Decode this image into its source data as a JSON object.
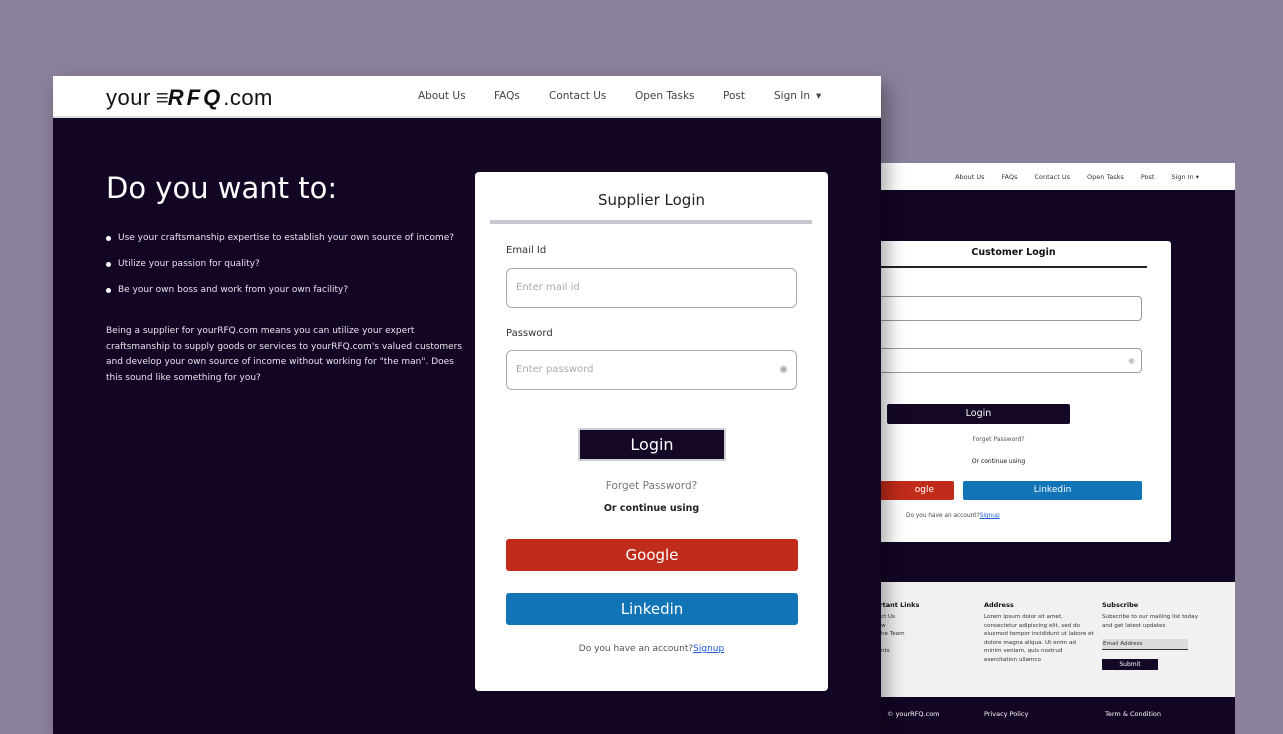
{
  "colors": {
    "background": "#8b819b",
    "dark_navy": "#130624",
    "google_red": "#c12b1a",
    "linkedin_blue": "#1074b6",
    "link_blue": "#1a56d6"
  },
  "back_window": {
    "nav": {
      "items": [
        "About Us",
        "FAQs",
        "Contact Us",
        "Open Tasks",
        "Post",
        "Sign In"
      ],
      "caret": "▾"
    },
    "login": {
      "title": "Customer Login",
      "eye_icon": "◉",
      "login_label": "Login",
      "forgot": "Forget Password?",
      "or_continue": "Or continue using",
      "google": "ogle",
      "linkedin": "Linkedin",
      "account_text": "Do you have an account?",
      "signup": "Signup"
    },
    "footer": {
      "links_title": "ortant Links",
      "links": [
        "ct Us",
        "w",
        "he Team",
        "",
        "nts"
      ],
      "address_title": "Address",
      "address_text": "Lorem ipsum dolor sit amet, consectetur adipiscing elit, sed do eiusmod tempor incididunt ut labore et dolore magna aliqua. Ut enim ad minim veniam, quis nostrud exercitation ullamco",
      "subscribe_title": "Subscribe",
      "subscribe_text": "Subscribe to our mailing list today and get latest updates",
      "email_placeholder": "Email Address",
      "submit": "Submit"
    },
    "bottom": {
      "copyright": "© yourRFQ.com",
      "privacy": "Privacy Policy",
      "terms": "Term & Condition"
    }
  },
  "front_window": {
    "logo": {
      "prefix": "your",
      "brand": "RFQ",
      "suffix": ".com"
    },
    "nav": {
      "items": [
        "About Us",
        "FAQs",
        "Contact Us",
        "Open Tasks",
        "Post",
        "Sign In"
      ],
      "caret": "▾"
    },
    "hero": {
      "title": "Do you want to:",
      "bullets": [
        "Use your craftsmanship expertise to establish your own source of income?",
        "Utilize your passion for quality?",
        "Be your own boss and work from your own facility?"
      ],
      "paragraph": "Being a supplier for yourRFQ.com means you can utilize your expert craftsmanship to supply goods or services to yourRFQ.com's valued customers and develop your own source of income without working for \"the man\". Does this sound like something for you?"
    },
    "login": {
      "title": "Supplier Login",
      "email_label": "Email Id",
      "email_placeholder": "Enter mail id",
      "password_label": "Password",
      "password_placeholder": "Enter password",
      "eye_icon": "◉",
      "login_label": "Login",
      "forgot": "Forget Password?",
      "or_continue": "Or continue using",
      "google": "Google",
      "linkedin": "Linkedin",
      "account_text": "Do you have an account?",
      "signup": "Signup"
    }
  }
}
